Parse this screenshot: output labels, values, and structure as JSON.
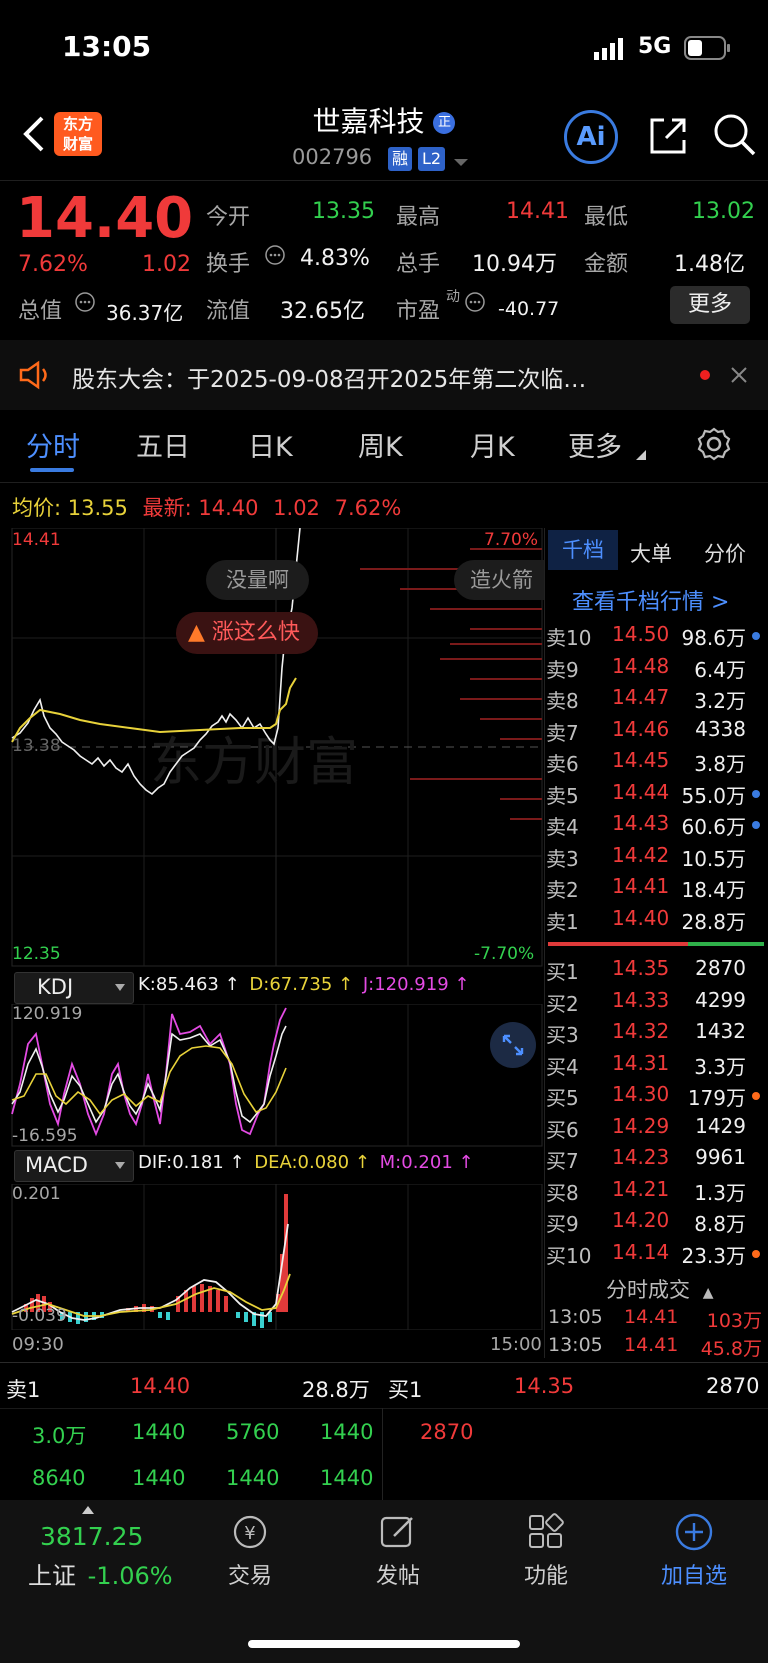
{
  "status": {
    "time": "13:05",
    "network": "5G"
  },
  "header": {
    "logo_line1": "东方",
    "logo_line2": "财富",
    "name": "世嘉科技",
    "name_badge": "正",
    "code": "002796",
    "tag1": "融",
    "tag2": "L2",
    "ai_label": "Ai"
  },
  "quote": {
    "price": "14.40",
    "change_pct": "7.62%",
    "change": "1.02",
    "open_label": "今开",
    "open": "13.35",
    "high_label": "最高",
    "high": "14.41",
    "low_label": "最低",
    "low": "13.02",
    "turnover_label": "换手",
    "turnover": "4.83%",
    "volume_label": "总手",
    "volume": "10.94万",
    "amount_label": "金额",
    "amount": "1.48亿",
    "mktcap_label": "总值",
    "mktcap": "36.37亿",
    "float_label": "流值",
    "float": "32.65亿",
    "pe_label": "市盈",
    "pe_sup": "动",
    "pe": "-40.77",
    "more_button": "更多"
  },
  "notice": {
    "text": "股东大会：于2025-09-08召开2025年第二次临…"
  },
  "tabs": [
    "分时",
    "五日",
    "日K",
    "周K",
    "月K",
    "更多"
  ],
  "chart_info": {
    "avg_label": "均价:",
    "avg": "13.55",
    "latest_label": "最新:",
    "latest": "14.40",
    "latest_change": "1.02",
    "latest_pct": "7.62%",
    "y_top": "14.41",
    "y_bottom": "12.35",
    "y_mid": "13.38",
    "pct_top": "7.70%",
    "pct_bottom": "-7.70%",
    "bubble1": "没量啊",
    "bubble2": "造火箭",
    "bubble3": "涨这么快",
    "watermark": "东方财富",
    "time_start": "09:30",
    "time_end": "15:00"
  },
  "kdj": {
    "name": "KDJ",
    "k": "K:85.463 ↑",
    "d": "D:67.735 ↑",
    "j": "J:120.919 ↑",
    "top": "120.919",
    "bottom": "-16.595"
  },
  "macd": {
    "name": "MACD",
    "dif": "DIF:0.181 ↑",
    "dea": "DEA:0.080 ↑",
    "m": "M:0.201 ↑",
    "top": "0.201",
    "bottom": "-0.039"
  },
  "orderbook": {
    "tabs": [
      "千档",
      "大单",
      "分价"
    ],
    "link": "查看千档行情 >",
    "sells": [
      {
        "label": "卖10",
        "price": "14.50",
        "vol": "98.6万",
        "dot": "#3a7be0"
      },
      {
        "label": "卖9",
        "price": "14.48",
        "vol": "6.4万",
        "dot": ""
      },
      {
        "label": "卖8",
        "price": "14.47",
        "vol": "3.2万",
        "dot": ""
      },
      {
        "label": "卖7",
        "price": "14.46",
        "vol": "4338",
        "dot": ""
      },
      {
        "label": "卖6",
        "price": "14.45",
        "vol": "3.8万",
        "dot": ""
      },
      {
        "label": "卖5",
        "price": "14.44",
        "vol": "55.0万",
        "dot": "#3a7be0"
      },
      {
        "label": "卖4",
        "price": "14.43",
        "vol": "60.6万",
        "dot": "#3a7be0"
      },
      {
        "label": "卖3",
        "price": "14.42",
        "vol": "10.5万",
        "dot": ""
      },
      {
        "label": "卖2",
        "price": "14.41",
        "vol": "18.4万",
        "dot": ""
      },
      {
        "label": "卖1",
        "price": "14.40",
        "vol": "28.8万",
        "dot": ""
      }
    ],
    "buys": [
      {
        "label": "买1",
        "price": "14.35",
        "vol": "2870",
        "dot": ""
      },
      {
        "label": "买2",
        "price": "14.33",
        "vol": "4299",
        "dot": ""
      },
      {
        "label": "买3",
        "price": "14.32",
        "vol": "1432",
        "dot": ""
      },
      {
        "label": "买4",
        "price": "14.31",
        "vol": "3.3万",
        "dot": ""
      },
      {
        "label": "买5",
        "price": "14.30",
        "vol": "179万",
        "dot": "#ff6a1a"
      },
      {
        "label": "买6",
        "price": "14.29",
        "vol": "1429",
        "dot": ""
      },
      {
        "label": "买7",
        "price": "14.23",
        "vol": "9961",
        "dot": ""
      },
      {
        "label": "买8",
        "price": "14.21",
        "vol": "1.3万",
        "dot": ""
      },
      {
        "label": "买9",
        "price": "14.20",
        "vol": "8.8万",
        "dot": ""
      },
      {
        "label": "买10",
        "price": "14.14",
        "vol": "23.3万",
        "dot": "#ff6a1a"
      }
    ],
    "ticks_header": "分时成交",
    "ticks": [
      {
        "time": "13:05",
        "price": "14.41",
        "vol": "103万"
      },
      {
        "time": "13:05",
        "price": "14.41",
        "vol": "45.8万"
      }
    ]
  },
  "queue": {
    "sell_label": "卖1",
    "sell_price": "14.40",
    "sell_vol": "28.8万",
    "buy_label": "买1",
    "buy_price": "14.35",
    "buy_vol": "2870",
    "sell_row1": [
      "3.0万",
      "1440",
      "5760",
      "1440"
    ],
    "sell_row2": [
      "8640",
      "1440",
      "1440",
      "1440"
    ],
    "buy_row1": [
      "2870"
    ]
  },
  "bottom": {
    "index_value": "3817.25",
    "index_name": "上证",
    "index_change": "-1.06%",
    "nav": [
      "交易",
      "发帖",
      "功能",
      "加自选"
    ]
  }
}
